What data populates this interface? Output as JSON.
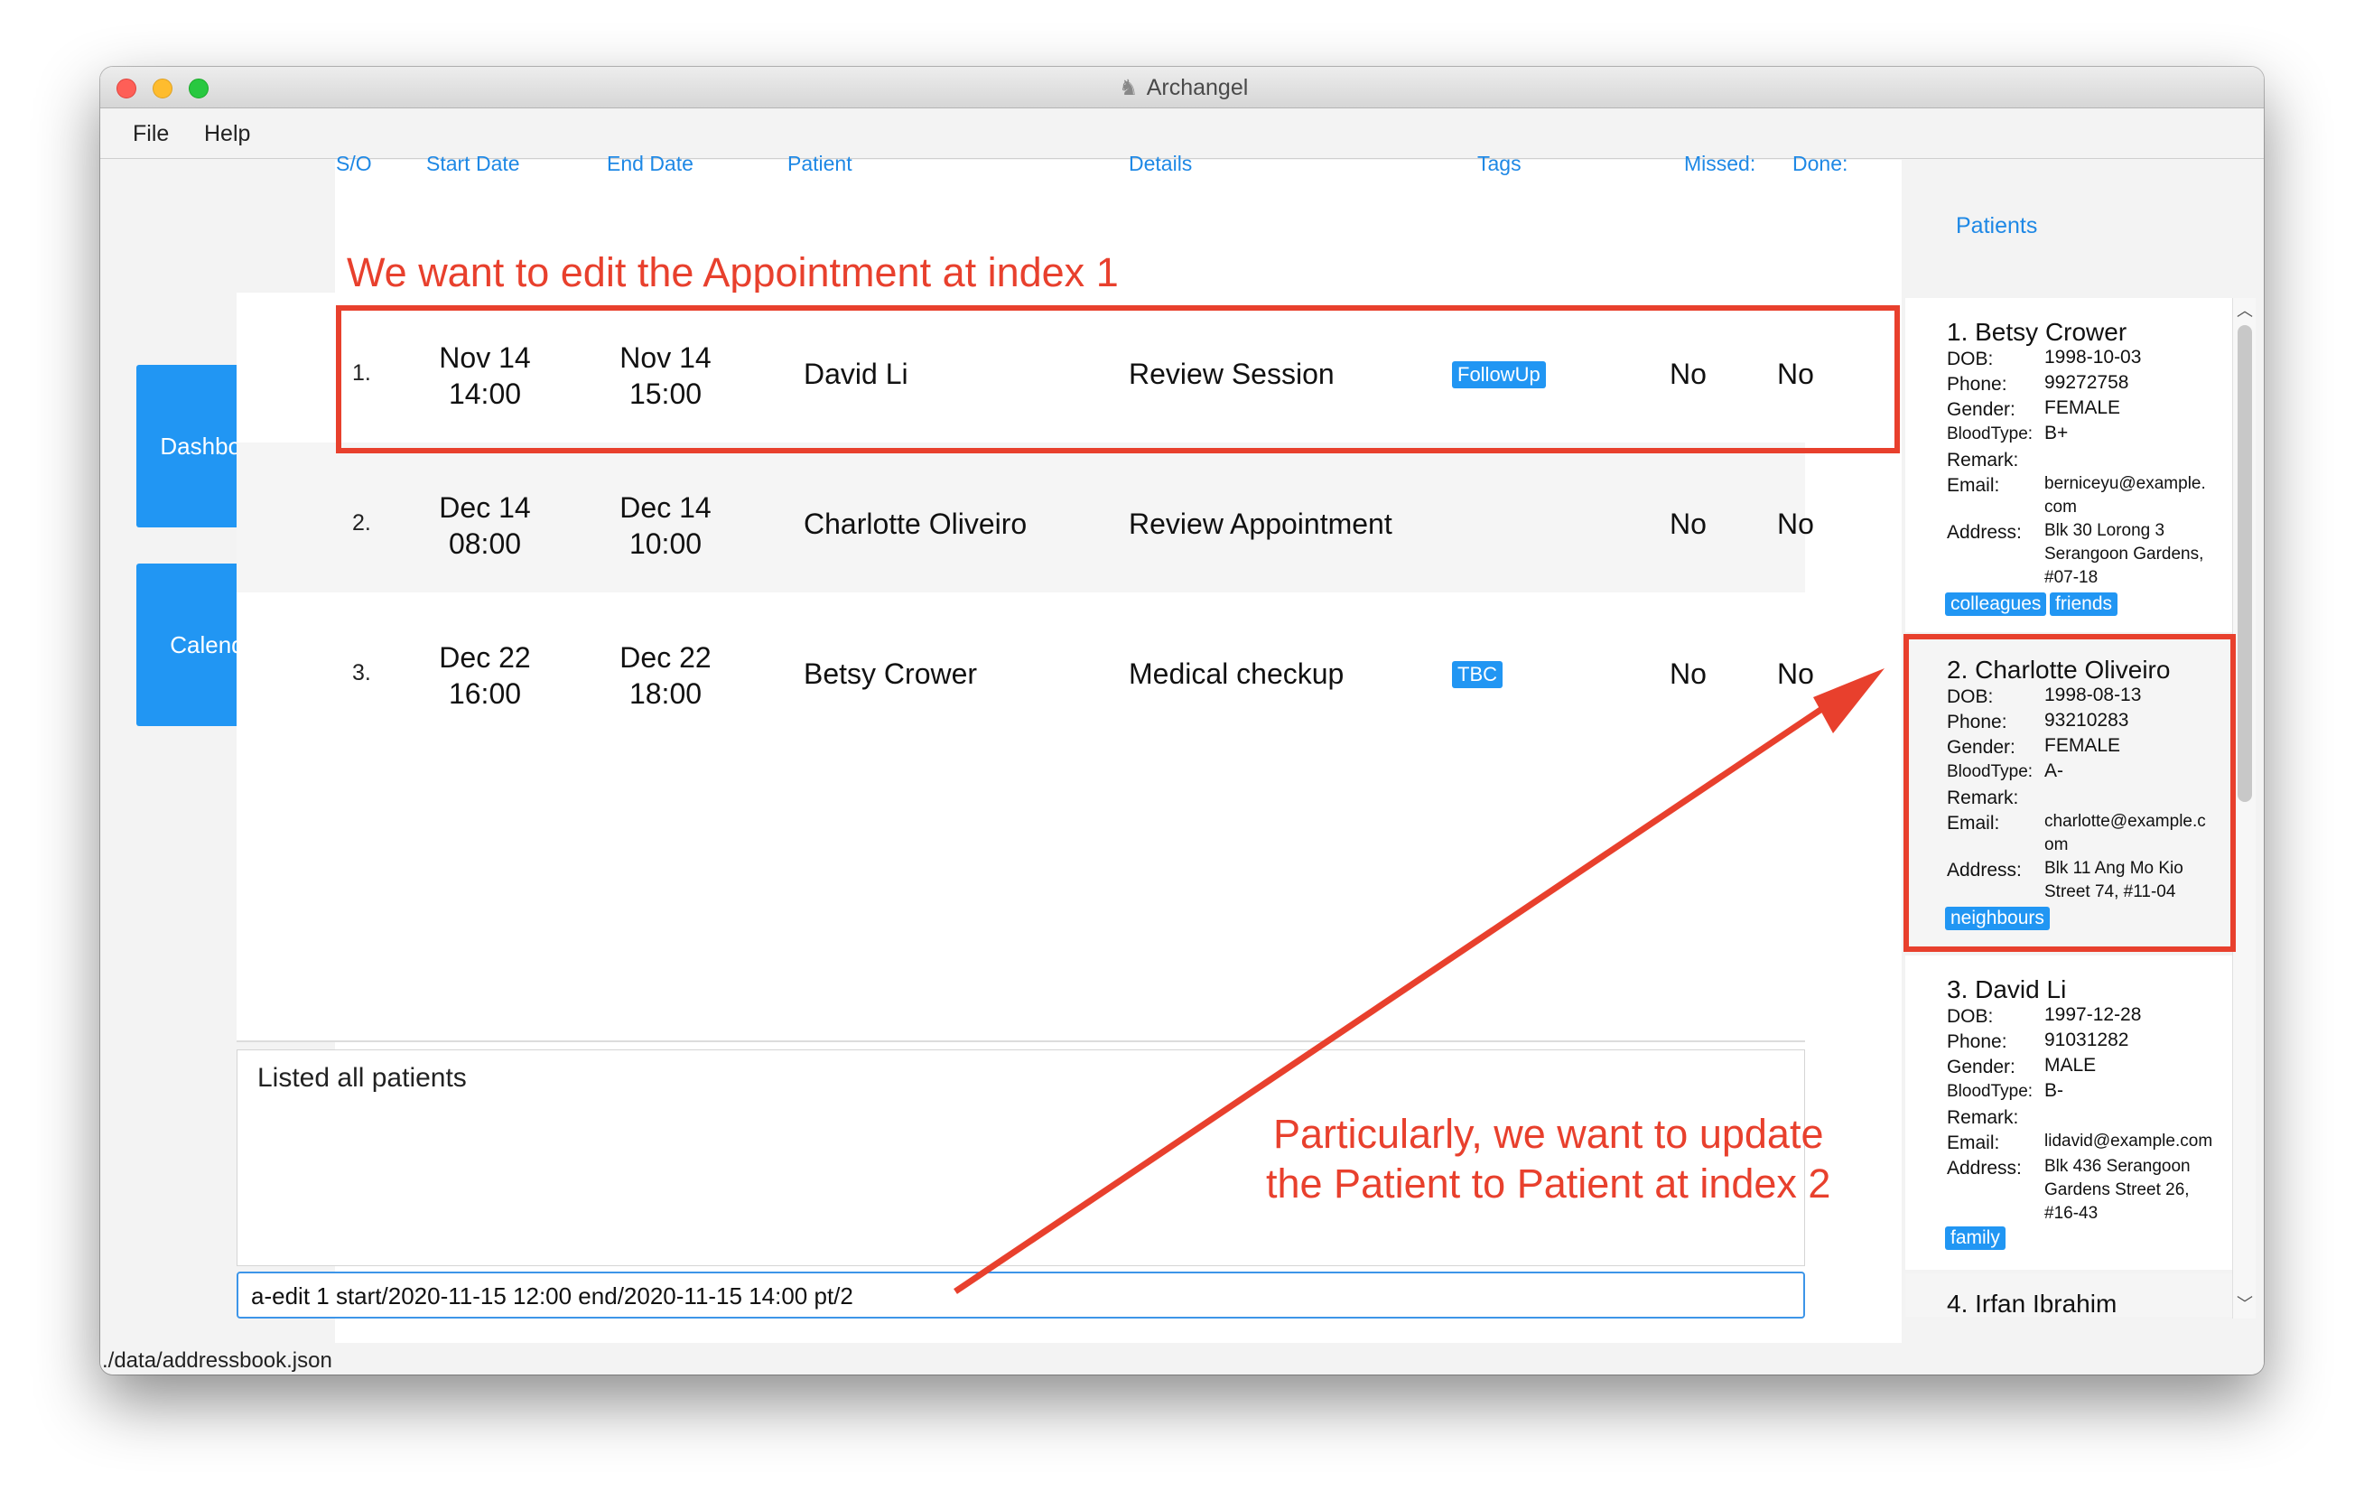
{
  "window": {
    "title": "Archangel"
  },
  "menu": [
    "File",
    "Help"
  ],
  "nav": {
    "dashboard_label": "Dashboard",
    "calendar_label": "Calendar"
  },
  "columns": {
    "so": "S/O",
    "start": "Start Date",
    "end": "End Date",
    "patient": "Patient",
    "details": "Details",
    "tags": "Tags",
    "missed": "Missed:",
    "done": "Done:"
  },
  "appointments": [
    {
      "index": "1.",
      "start_date": "Nov 14",
      "start_time": "14:00",
      "end_date": "Nov 14",
      "end_time": "15:00",
      "patient": "David Li",
      "details": "Review Session",
      "tag": "FollowUp",
      "missed": "No",
      "done": "No"
    },
    {
      "index": "2.",
      "start_date": "Dec 14",
      "start_time": "08:00",
      "end_date": "Dec 14",
      "end_time": "10:00",
      "patient": "Charlotte Oliveiro",
      "details": "Review Appointment",
      "tag": "",
      "missed": "No",
      "done": "No"
    },
    {
      "index": "3.",
      "start_date": "Dec 22",
      "start_time": "16:00",
      "end_date": "Dec 22",
      "end_time": "18:00",
      "patient": "Betsy Crower",
      "details": "Medical checkup",
      "tag": "TBC",
      "missed": "No",
      "done": "No"
    }
  ],
  "result_display": "Listed all patients",
  "command_input": "a-edit 1 start/2020-11-15 12:00 end/2020-11-15 14:00 pt/2",
  "status_bar": "./data/addressbook.json",
  "patients_title": "Patients",
  "field_labels": {
    "dob": "DOB:",
    "phone": "Phone:",
    "gender": "Gender:",
    "blood": "BloodType:",
    "remark": "Remark:",
    "email": "Email:",
    "address": "Address:"
  },
  "patients": [
    {
      "name": "1. Betsy Crower",
      "dob": "1998-10-03",
      "phone": "99272758",
      "gender": "FEMALE",
      "blood": "B+",
      "remark": "",
      "email_1": "berniceyu@example.",
      "email_2": "com",
      "address_1": "Blk 30 Lorong 3",
      "address_2": "Serangoon Gardens,",
      "address_3": "#07-18",
      "tags": [
        "colleagues",
        "friends"
      ]
    },
    {
      "name": "2. Charlotte Oliveiro",
      "dob": "1998-08-13",
      "phone": "93210283",
      "gender": "FEMALE",
      "blood": "A-",
      "remark": "",
      "email_1": "charlotte@example.c",
      "email_2": "om",
      "address_1": "Blk 11 Ang Mo Kio",
      "address_2": "Street 74, #11-04",
      "tags": [
        "neighbours"
      ]
    },
    {
      "name": "3. David Li",
      "dob": "1997-12-28",
      "phone": "91031282",
      "gender": "MALE",
      "blood": "B-",
      "remark": "",
      "email_1": "lidavid@example.com",
      "address_1": "Blk 436 Serangoon",
      "address_2": "Gardens Street 26,",
      "address_3": "#16-43",
      "tags": [
        "family"
      ]
    },
    {
      "name": "4. Irfan Ibrahim"
    }
  ],
  "annotations": {
    "top": "We want to edit the Appointment at index 1",
    "bottom_1": "Particularly, we want to update",
    "bottom_2": "the Patient to Patient at index 2"
  },
  "colors": {
    "accent": "#2196f3",
    "annotation": "#e8402d"
  },
  "icons": [
    "archangel-app-icon",
    "scroll-up-icon",
    "scroll-down-icon"
  ]
}
